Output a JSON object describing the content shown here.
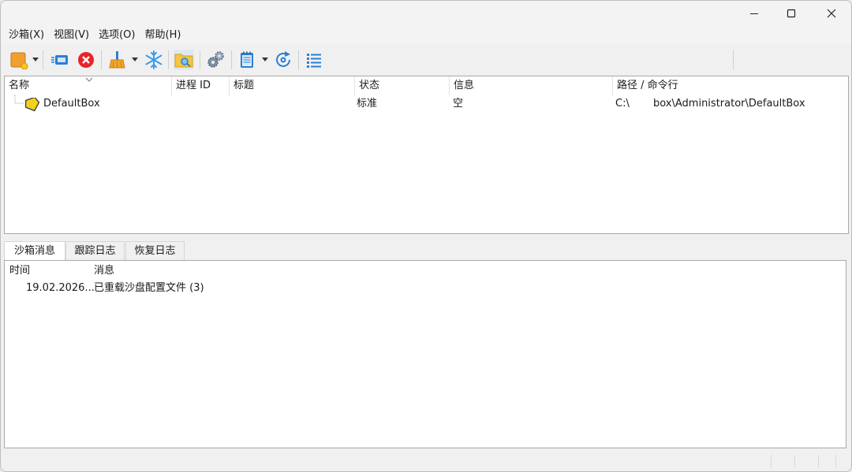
{
  "window": {
    "controls": [
      "minimize",
      "maximize",
      "close"
    ]
  },
  "menu": [
    "沙箱(X)",
    "视图(V)",
    "选项(O)",
    "帮助(H)"
  ],
  "toolbar": {
    "icons": [
      "new-sandbox-icon",
      "run-program-icon",
      "terminate-all-icon",
      "cleanup-icon",
      "freeze-icon",
      "explore-icon",
      "settings-icon",
      "view-log-icon",
      "refresh-icon",
      "list-view-icon"
    ]
  },
  "sandbox_list": {
    "columns": [
      "名称",
      "进程 ID",
      "标题",
      "状态",
      "信息",
      "路径 / 命令行"
    ],
    "rows": [
      {
        "name": "DefaultBox",
        "pid": "",
        "title": "",
        "status": "标准",
        "info": "空",
        "path_prefix": "C:\\",
        "path_suffix": "box\\Administrator\\DefaultBox"
      }
    ]
  },
  "tabs": [
    {
      "label": "沙箱消息",
      "active": true
    },
    {
      "label": "跟踪日志",
      "active": false
    },
    {
      "label": "恢复日志",
      "active": false
    }
  ],
  "messages": {
    "columns": [
      "时间",
      "消息"
    ],
    "rows": [
      {
        "time": "19.02.2026...",
        "message": "已重载沙盘配置文件 (3)"
      }
    ]
  },
  "colors": {
    "accent": "#0067c0",
    "sandbox_icon": "#f2d21b",
    "stop_red": "#e8242a"
  }
}
